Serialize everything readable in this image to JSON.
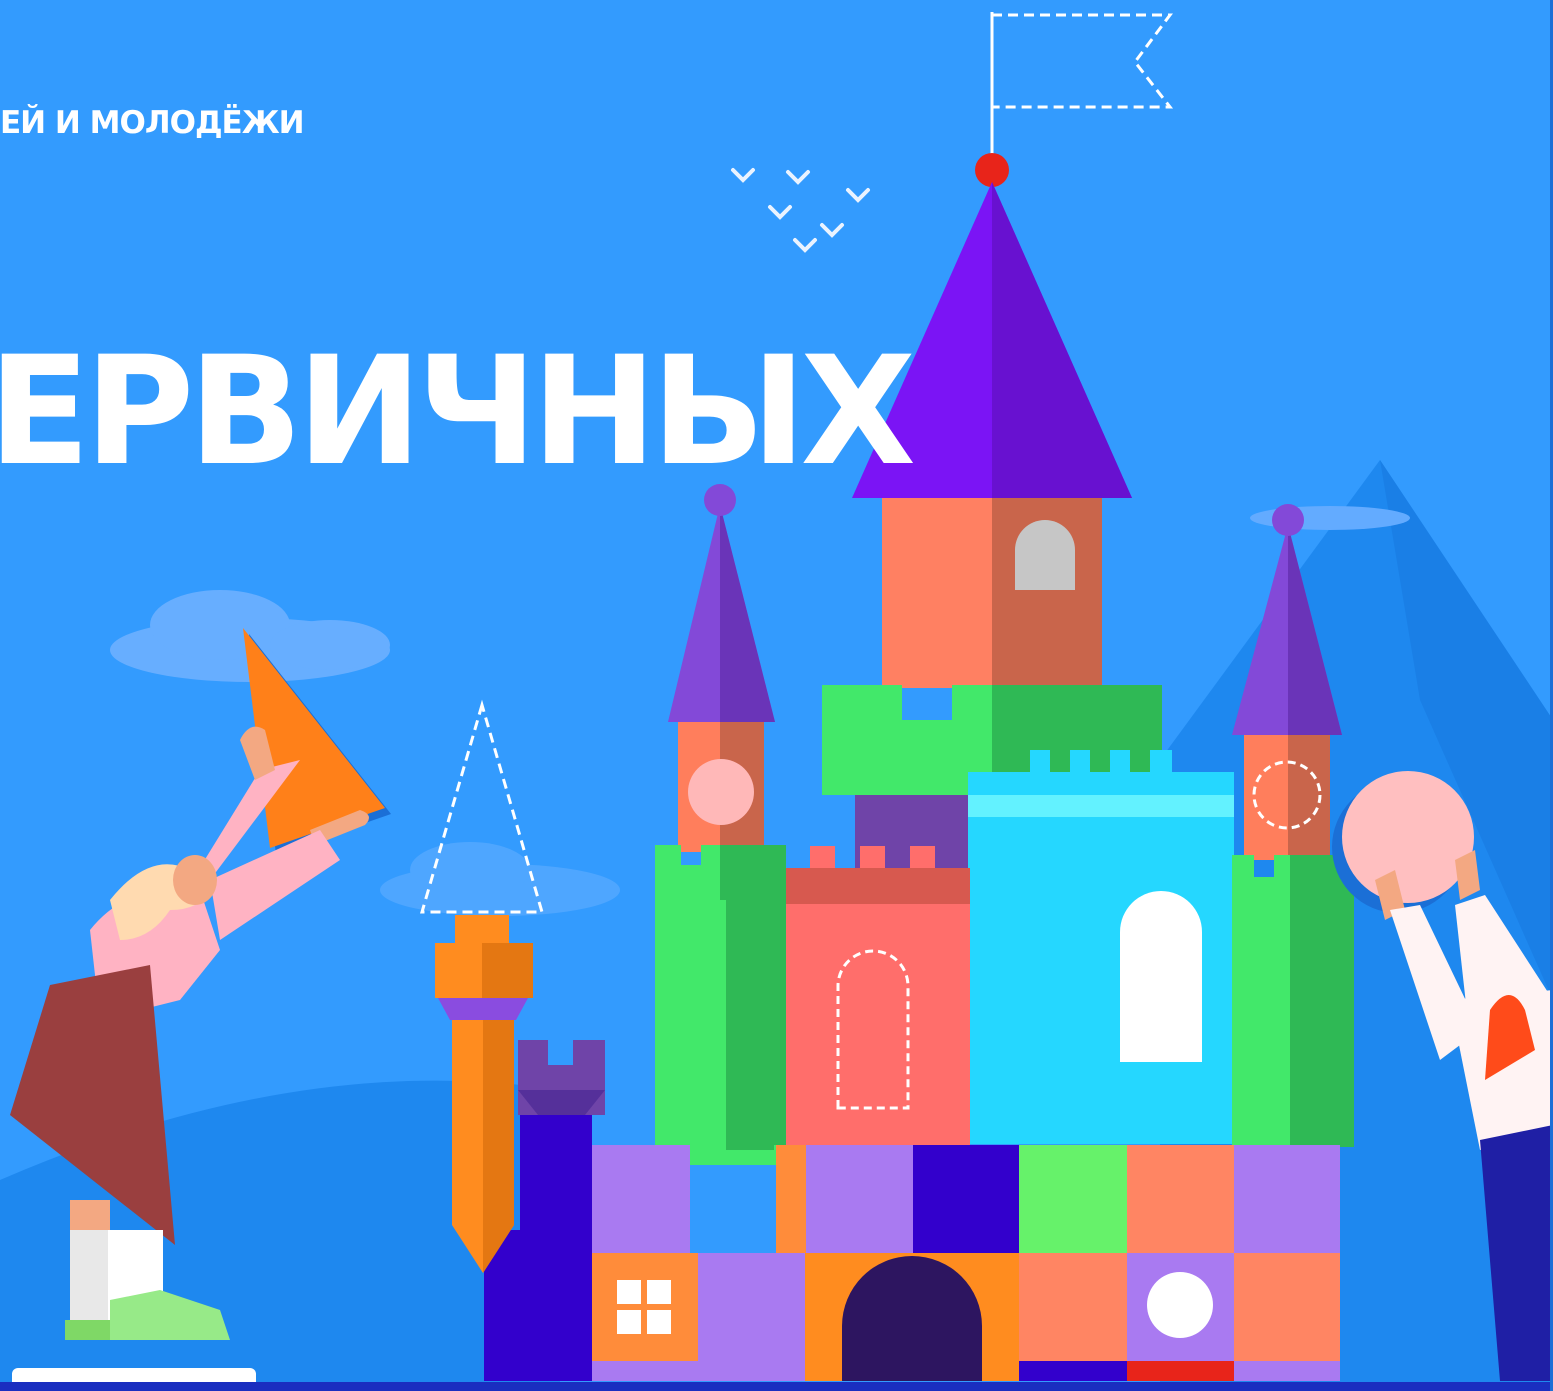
{
  "header": {
    "org_text": "ЕЙ И МОЛОДЁЖИ"
  },
  "hero": {
    "title_line1": "ЕРВИЧНЫХ"
  },
  "colors": {
    "background": "#339BFE",
    "mountain": "#1E88EF",
    "purple_roof": "#7B14F5",
    "tower_salmon": "#FF8062",
    "green": "#42E86A",
    "cyan": "#25D7FF",
    "orange": "#FF8C1F",
    "navy": "#2D1560"
  },
  "icons": {
    "flag": "flag-outline-icon",
    "birds": "birds-icon"
  }
}
